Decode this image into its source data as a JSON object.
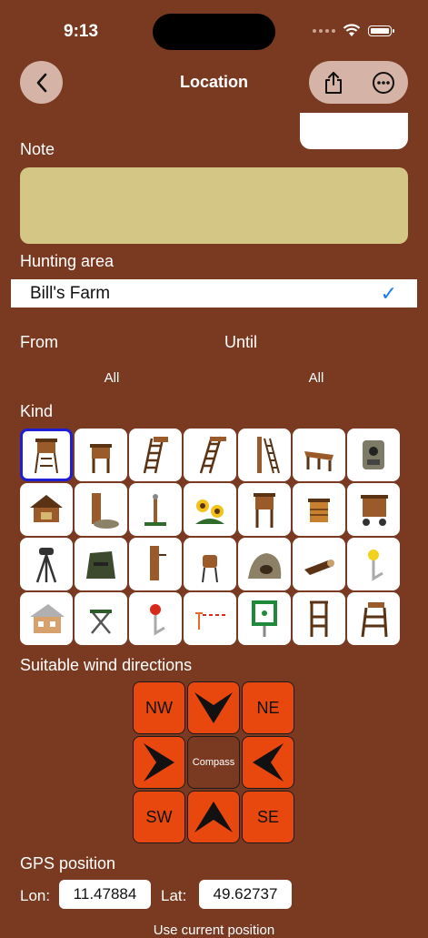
{
  "status_bar": {
    "time": "9:13",
    "icons": [
      "signal-dots-icon",
      "wifi-icon",
      "battery-icon"
    ]
  },
  "nav": {
    "title": "Location",
    "back_icon": "chevron-left-icon",
    "actions": [
      "share-icon",
      "more-icon"
    ]
  },
  "note": {
    "label": "Note",
    "value": ""
  },
  "hunting_area": {
    "label": "Hunting area",
    "selected": "Bill's Farm",
    "check_icon": "checkmark-icon"
  },
  "period": {
    "from_label": "From",
    "until_label": "Until",
    "from_value": "All",
    "until_value": "All"
  },
  "kind": {
    "label": "Kind",
    "selected_index": 0,
    "items": [
      "high-seat-icon",
      "small-stand-icon",
      "ladder-stand-icon",
      "tall-ladder-icon",
      "tree-ladder-icon",
      "bench-icon",
      "trail-camera-icon",
      "feeding-hut-icon",
      "salt-lick-stump-icon",
      "marker-post-icon",
      "flowers-icon",
      "elevated-hide-icon",
      "box-feeder-icon",
      "mobile-stand-icon",
      "tripod-scope-icon",
      "ground-blind-icon",
      "stump-pole-icon",
      "barrel-feeder-icon",
      "rock-den-icon",
      "log-icon",
      "yellow-pin-icon",
      "lodge-icon",
      "folding-stool-icon",
      "red-pin-icon",
      "barrier-icon",
      "assembly-point-sign-icon",
      "hunting-chair-icon",
      "ladder-seat-icon"
    ]
  },
  "wind": {
    "label": "Suitable wind directions",
    "nw": "NW",
    "ne": "NE",
    "sw": "SW",
    "se": "SE",
    "center": "Compass",
    "colors": {
      "active": "#e8470d",
      "center": "#7a3a22"
    }
  },
  "gps": {
    "label": "GPS position",
    "lon_label": "Lon:",
    "lon": "11.47884",
    "lat_label": "Lat:",
    "lat": "49.62737",
    "use_current": "Use current position"
  },
  "colors": {
    "background": "#7a3a22",
    "note_field": "#d4c685",
    "selection": "#1e1ed6",
    "checkmark": "#1a7cf5"
  }
}
